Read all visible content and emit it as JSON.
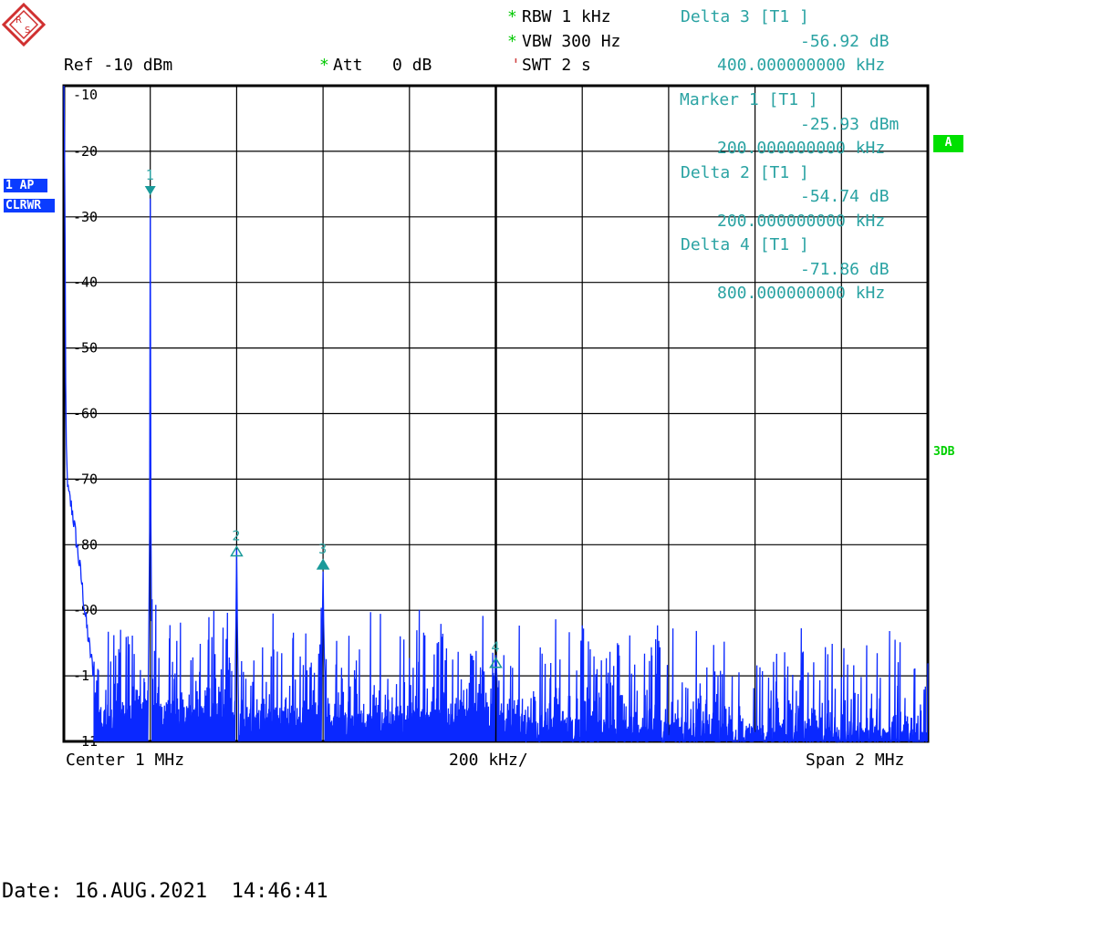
{
  "header": {
    "rbw": "RBW 1 kHz",
    "vbw": "VBW 300 Hz",
    "swt": "SWT 2 s",
    "ref": "Ref -10 dBm",
    "att": "Att   0 dB",
    "star": "*",
    "swt_mark": "'"
  },
  "markers_panel": {
    "delta3_title": "Delta 3 [T1 ]",
    "delta3_value": "-56.92 dB",
    "delta3_freq": "400.000000000 kHz",
    "marker1_title": "Marker 1 [T1 ]",
    "marker1_value": "-25.93 dBm",
    "marker1_freq": "200.000000000 kHz",
    "delta2_title": "Delta 2 [T1 ]",
    "delta2_value": "-54.74 dB",
    "delta2_freq": "200.000000000 kHz",
    "delta4_title": "Delta 4 [T1 ]",
    "delta4_value": "-71.86 dB",
    "delta4_freq": "800.000000000 kHz"
  },
  "side": {
    "trace_badge_1": "1 AP",
    "trace_badge_2": "CLRWR",
    "a_badge": "A",
    "threedb": "3DB"
  },
  "footer": {
    "center": "Center 1 MHz",
    "div": "200 kHz/",
    "span": "Span 2 MHz",
    "date": "Date: 16.AUG.2021  14:46:41"
  },
  "colors": {
    "trace": "#0a28ff",
    "marker": "#1a9a9a",
    "grid": "#000000"
  },
  "chart_data": {
    "type": "line",
    "title": "",
    "xlabel": "",
    "ylabel": "",
    "xlim": [
      0,
      2000
    ],
    "ylim": [
      -110,
      -10
    ],
    "ytick_labels": [
      "-10",
      "-20",
      "-30",
      "-40",
      "-50",
      "-60",
      "-70",
      "-80",
      "-90",
      "-1",
      "-11"
    ],
    "series": [
      {
        "noise_floor": -108,
        "points": [
          [
            0,
            -10
          ],
          [
            2,
            -20
          ],
          [
            4,
            -55
          ],
          [
            6,
            -67
          ],
          [
            10,
            -72
          ],
          [
            20,
            -75
          ],
          [
            30,
            -80
          ],
          [
            40,
            -85
          ],
          [
            50,
            -91
          ],
          [
            60,
            -96
          ],
          [
            70,
            -100
          ],
          [
            80,
            -104
          ],
          [
            100,
            -106
          ],
          [
            195,
            -102
          ],
          [
            198,
            -85
          ],
          [
            199,
            -70
          ],
          [
            200,
            -26
          ],
          [
            201,
            -70
          ],
          [
            202,
            -88
          ],
          [
            205,
            -104
          ],
          [
            395,
            -104
          ],
          [
            398,
            -95
          ],
          [
            400,
            -81
          ],
          [
            402,
            -95
          ],
          [
            405,
            -106
          ],
          [
            595,
            -104
          ],
          [
            598,
            -95
          ],
          [
            600,
            -83
          ],
          [
            602,
            -95
          ],
          [
            605,
            -106
          ],
          [
            995,
            -104
          ],
          [
            998,
            -100
          ],
          [
            1000,
            -98
          ],
          [
            1002,
            -100
          ],
          [
            1005,
            -106
          ],
          [
            2000,
            -108
          ]
        ]
      }
    ],
    "markers": [
      {
        "label": "1",
        "x": 200,
        "y": -26,
        "dir": "down"
      },
      {
        "label": "2",
        "x": 400,
        "y": -81,
        "dir": "up"
      },
      {
        "label": "3",
        "x": 600,
        "y": -83,
        "dir": "up"
      },
      {
        "label": "4",
        "x": 1000,
        "y": -98,
        "dir": "up"
      }
    ]
  }
}
